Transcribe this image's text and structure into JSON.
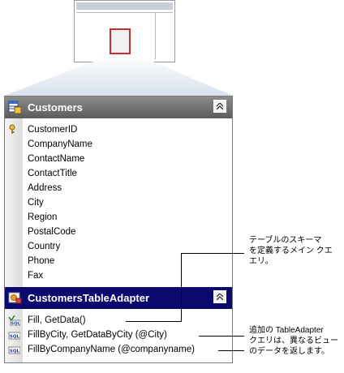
{
  "table": {
    "title": "Customers",
    "columns": [
      "CustomerID",
      "CompanyName",
      "ContactName",
      "ContactTitle",
      "Address",
      "City",
      "Region",
      "PostalCode",
      "Country",
      "Phone",
      "Fax"
    ]
  },
  "adapter": {
    "title": "CustomersTableAdapter",
    "queries": [
      "Fill, GetData()",
      "FillByCity, GetDataByCity (@City)",
      "FillByCompanyName (@companyname)"
    ],
    "query_icon_text": "SQL"
  },
  "notes": {
    "main_lines": [
      "テーブルのスキーマ",
      "を定義するメイン クエ",
      "エリ。"
    ],
    "additional_lines": [
      "追加の TableAdapter",
      "クエリは、異なるビュー",
      "のデータを返します。"
    ]
  },
  "colors": {
    "table_header": "#6e6e6e",
    "adapter_header": "#0a0a6e",
    "thumb_highlight": "#c03030"
  }
}
